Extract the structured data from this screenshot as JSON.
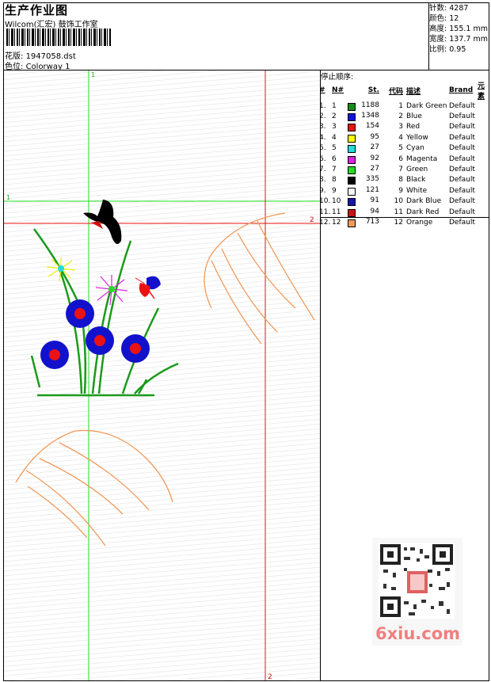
{
  "header": {
    "title": "生产作业图",
    "company": "Wilcom(汇宏) 鼓饰工作室",
    "pattern_label": "花版:",
    "pattern_value": "1947058.dst",
    "color_label": "色位:",
    "color_value": "Colorway 1"
  },
  "stats": {
    "stitches_label": "针数:",
    "stitches_value": "4287",
    "colors_label": "颜色:",
    "colors_value": "12",
    "height_label": "高度:",
    "height_value": "155.1 mm",
    "width_label": "宽度:",
    "width_value": "137.7 mm",
    "scale_label": "比例:",
    "scale_value": "0.95"
  },
  "stop_sequence": {
    "title": "停止顺序:",
    "headers": [
      "#",
      "N#",
      "St.",
      "代码",
      "描述",
      "Brand",
      "元素"
    ],
    "rows": [
      {
        "idx": "1.",
        "n": "1",
        "color": "#1a8a1a",
        "st": "1188",
        "code": "1",
        "desc": "Dark Green",
        "brand": "Default"
      },
      {
        "idx": "2.",
        "n": "2",
        "color": "#1010dd",
        "st": "1348",
        "code": "2",
        "desc": "Blue",
        "brand": "Default"
      },
      {
        "idx": "3.",
        "n": "3",
        "color": "#ee1111",
        "st": "154",
        "code": "3",
        "desc": "Red",
        "brand": "Default"
      },
      {
        "idx": "4.",
        "n": "4",
        "color": "#ffff00",
        "st": "95",
        "code": "4",
        "desc": "Yellow",
        "brand": "Default"
      },
      {
        "idx": "5.",
        "n": "5",
        "color": "#22dddd",
        "st": "27",
        "code": "5",
        "desc": "Cyan",
        "brand": "Default"
      },
      {
        "idx": "6.",
        "n": "6",
        "color": "#dd22dd",
        "st": "92",
        "code": "6",
        "desc": "Magenta",
        "brand": "Default"
      },
      {
        "idx": "7.",
        "n": "7",
        "color": "#22dd22",
        "st": "27",
        "code": "7",
        "desc": "Green",
        "brand": "Default"
      },
      {
        "idx": "8.",
        "n": "8",
        "color": "#000000",
        "st": "335",
        "code": "8",
        "desc": "Black",
        "brand": "Default"
      },
      {
        "idx": "9.",
        "n": "9",
        "color": "#f4f4f4",
        "st": "121",
        "code": "9",
        "desc": "White",
        "brand": "Default"
      },
      {
        "idx": "10.",
        "n": "10",
        "color": "#1616aa",
        "st": "91",
        "code": "10",
        "desc": "Dark Blue",
        "brand": "Default"
      },
      {
        "idx": "11.",
        "n": "11",
        "color": "#cc1111",
        "st": "94",
        "code": "11",
        "desc": "Dark Red",
        "brand": "Default"
      },
      {
        "idx": "12.",
        "n": "12",
        "color": "#f09a5a",
        "st": "713",
        "code": "12",
        "desc": "Orange",
        "brand": "Default"
      }
    ]
  },
  "guides": {
    "green_vertical_label": "1",
    "green_horizontal_label": "1",
    "red_vertical_label": "2",
    "red_horizontal_label": "2"
  },
  "watermark": "6xiu.com"
}
